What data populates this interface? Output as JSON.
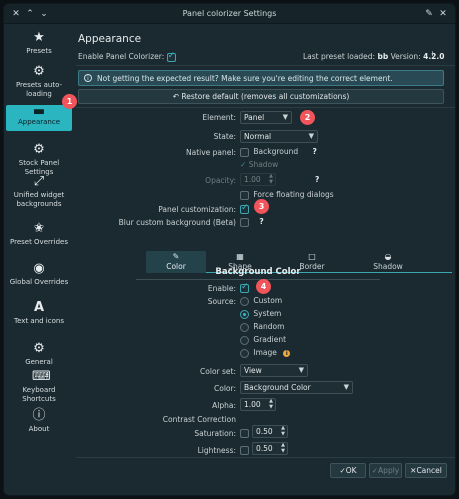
{
  "window": {
    "title": "Panel colorizer Settings"
  },
  "sidebar": {
    "items": [
      {
        "label": "Presets",
        "icon": "star-icon"
      },
      {
        "label": "Presets auto-loading",
        "icon": "sliders-icon"
      },
      {
        "label": "Appearance",
        "icon": "dash-icon"
      },
      {
        "label": "Stock Panel Settings",
        "icon": "gear-icon"
      },
      {
        "label": "Unified widget backgrounds",
        "icon": "diagonal-icon"
      },
      {
        "label": "Preset Overrides",
        "icon": "star-half-icon"
      },
      {
        "label": "Global Overrides",
        "icon": "globe-icon"
      },
      {
        "label": "Text and icons",
        "icon": "font-icon"
      },
      {
        "label": "General",
        "icon": "gear-icon"
      },
      {
        "label": "Keyboard Shortcuts",
        "icon": "keyboard-icon"
      },
      {
        "label": "About",
        "icon": "info-icon"
      }
    ]
  },
  "header": {
    "title": "Appearance",
    "enable_label": "Enable Panel Colorizer:",
    "last_preset_label": "Last preset loaded:",
    "last_preset_value": "bb",
    "version_label": "Version:",
    "version_value": "4.2.0"
  },
  "banner": {
    "text": "Not getting the expected result? Make sure you're editing the correct element."
  },
  "restore_button": "Restore default (removes all customizations)",
  "form": {
    "element_label": "Element:",
    "element_value": "Panel",
    "state_label": "State:",
    "state_value": "Normal",
    "native_panel_label": "Native panel:",
    "background_label": "Background",
    "shadow_label": "Shadow",
    "opacity_label": "Opacity:",
    "opacity_value": "1.00",
    "force_floating_label": "Force floating dialogs",
    "panel_customization_label": "Panel customization:",
    "blur_label": "Blur custom background (Beta)",
    "qmark": "?"
  },
  "tabs": [
    "Color",
    "Shape",
    "Border",
    "Shadow"
  ],
  "background_color": {
    "title": "Background Color",
    "enable_label": "Enable:",
    "source_label": "Source:",
    "sources": [
      "Custom",
      "System",
      "Random",
      "Gradient",
      "Image"
    ],
    "color_set_label": "Color set:",
    "color_set_value": "View",
    "color_label": "Color:",
    "color_value": "Background Color",
    "alpha_label": "Alpha:",
    "alpha_value": "1.00",
    "contrast_label": "Contrast Correction",
    "saturation_label": "Saturation:",
    "saturation_value": "0.50",
    "lightness_label": "Lightness:",
    "lightness_value": "0.50"
  },
  "footer": {
    "ok": "OK",
    "apply": "Apply",
    "cancel": "Cancel"
  },
  "badges": [
    "1",
    "2",
    "3",
    "4"
  ],
  "colors": {
    "accent": "#2bb5c0",
    "badge": "#f2545b",
    "window_bg": "#1b2a30"
  }
}
